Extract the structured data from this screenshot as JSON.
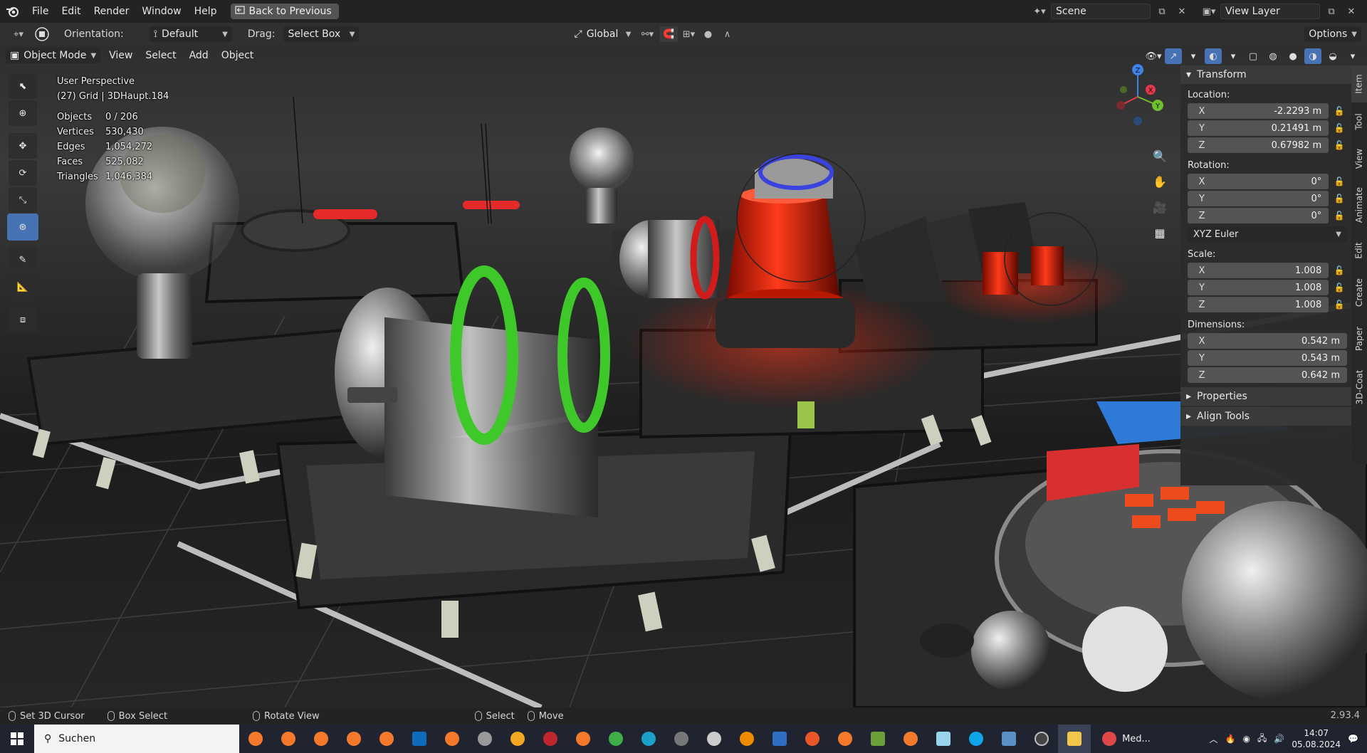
{
  "menubar": {
    "items": [
      "File",
      "Edit",
      "Render",
      "Window",
      "Help"
    ],
    "back_button": "Back to Previous",
    "scene_name": "Scene",
    "view_layer": "View Layer"
  },
  "toolheader": {
    "orientation_label": "Orientation:",
    "orientation_value": "Default",
    "drag_label": "Drag:",
    "drag_value": "Select Box",
    "transform_orientation": "Global",
    "options": "Options"
  },
  "viewport": {
    "mode": "Object Mode",
    "menus": [
      "View",
      "Select",
      "Add",
      "Object"
    ],
    "perspective": "User Perspective",
    "collection": "(27) Grid | 3DHaupt.184",
    "stats": [
      {
        "label": "Objects",
        "value": "0 / 206"
      },
      {
        "label": "Vertices",
        "value": "530,430"
      },
      {
        "label": "Edges",
        "value": "1,054,272"
      },
      {
        "label": "Faces",
        "value": "525,082"
      },
      {
        "label": "Triangles",
        "value": "1,046,384"
      }
    ],
    "gizmo_labels": {
      "x": "X",
      "y": "Y",
      "z": "Z"
    }
  },
  "npanel": {
    "transform_title": "Transform",
    "location_label": "Location:",
    "location": [
      {
        "axis": "X",
        "value": "-2.2293 m"
      },
      {
        "axis": "Y",
        "value": "0.21491 m"
      },
      {
        "axis": "Z",
        "value": "0.67982 m"
      }
    ],
    "rotation_label": "Rotation:",
    "rotation": [
      {
        "axis": "X",
        "value": "0°"
      },
      {
        "axis": "Y",
        "value": "0°"
      },
      {
        "axis": "Z",
        "value": "0°"
      }
    ],
    "rotation_mode": "XYZ Euler",
    "scale_label": "Scale:",
    "scale": [
      {
        "axis": "X",
        "value": "1.008"
      },
      {
        "axis": "Y",
        "value": "1.008"
      },
      {
        "axis": "Z",
        "value": "1.008"
      }
    ],
    "dimensions_label": "Dimensions:",
    "dimensions": [
      {
        "axis": "X",
        "value": "0.542 m"
      },
      {
        "axis": "Y",
        "value": "0.543 m"
      },
      {
        "axis": "Z",
        "value": "0.642 m"
      }
    ],
    "properties": "Properties",
    "align_tools": "Align Tools",
    "tabs": [
      "Item",
      "Tool",
      "View",
      "Animate",
      "Edit",
      "Create",
      "Paper",
      "3D-Coat"
    ]
  },
  "statusbar": {
    "items": [
      "Set 3D Cursor",
      "Box Select",
      "Rotate View",
      "Select",
      "Move"
    ],
    "version": "2.93.4"
  },
  "taskbar": {
    "search_placeholder": "Suchen",
    "active_app_label": "Med...",
    "time": "14:07",
    "date": "05.08.2024"
  },
  "colors": {
    "accent": "#4772b3",
    "axis_x": "#e8394a",
    "axis_y": "#6fbf2f",
    "axis_z": "#3d82e6"
  }
}
